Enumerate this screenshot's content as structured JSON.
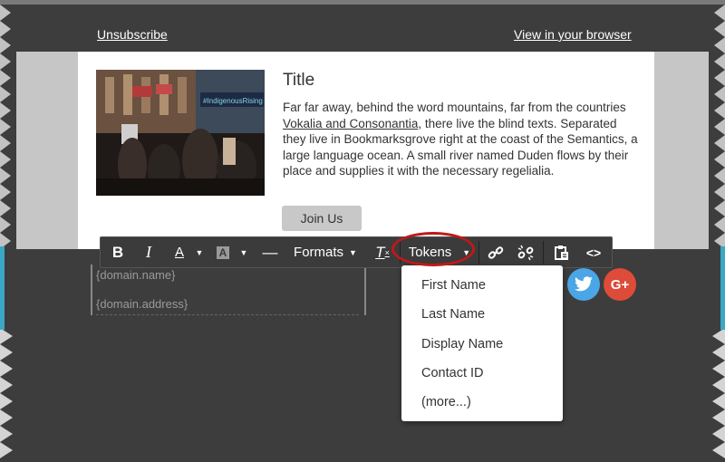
{
  "email": {
    "unsubscribe": "Unsubscribe",
    "view_in_browser": "View in your browser",
    "title": "Title",
    "body_before": "Far far away, behind the word mountains, far from the countries ",
    "body_link": "Vokalia and Consonantia",
    "body_after": ", there live the blind texts. Separated they live in Bookmarksgrove right at the coast of the Semantics, a large language ocean. A small river named Duden flows by their place and supplies it with the necessary regelialia.",
    "join_button": "Join Us",
    "photo_caption": "#IndigenousRising"
  },
  "toolbar": {
    "bold": "B",
    "italic": "I",
    "text_color": "A",
    "bg_color": "A",
    "hr": "—",
    "formats": "Formats",
    "clear_format": "T",
    "tokens": "Tokens",
    "code": "<>"
  },
  "editor": {
    "line1": "{domain.name}",
    "line2": "{domain.address}"
  },
  "tokens_menu": {
    "items": [
      "First Name",
      "Last Name",
      "Display Name",
      "Contact ID",
      "(more...)"
    ]
  },
  "social": {
    "twitter_color": "#4aa6e6",
    "google_color": "#dd4b39",
    "google_label": "G+"
  },
  "colors": {
    "highlight_ring": "#c01818",
    "side_accent": "#3aa7c4"
  }
}
